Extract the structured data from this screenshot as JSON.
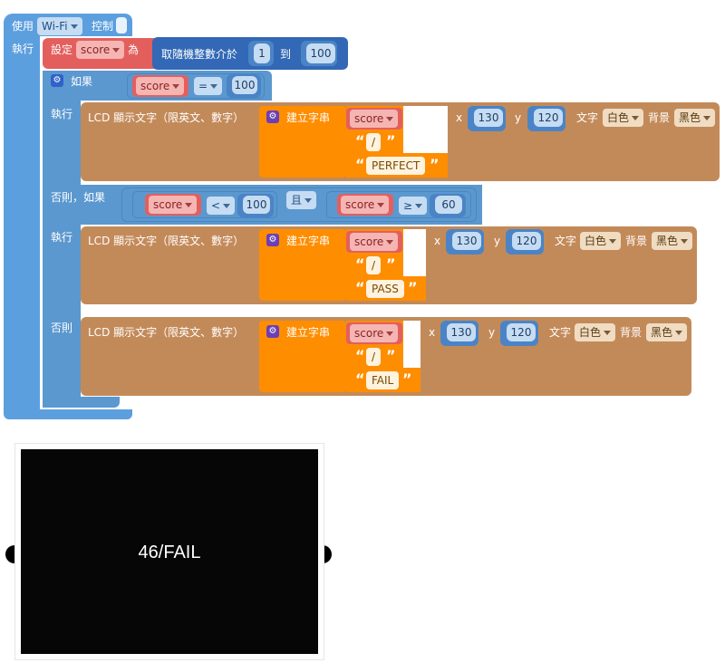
{
  "wifi_block": {
    "label_use": "使用",
    "wifi_option": "Wi-Fi",
    "label_control": "控制"
  },
  "main_block": {
    "label_do": "執行"
  },
  "set_block": {
    "label_set": "設定",
    "var": "score",
    "label_as": "為"
  },
  "random_block": {
    "label": "取隨機整數介於",
    "from": "1",
    "label_to": "到",
    "to": "100"
  },
  "if_block": {
    "label_if": "如果",
    "label_do": "執行",
    "label_elseif": "否則，如果",
    "label_do2": "執行",
    "label_else": "否則"
  },
  "cond1": {
    "var": "score",
    "op": "=",
    "value": "100"
  },
  "cond2": {
    "left": {
      "var": "score",
      "op": "<",
      "value": "100"
    },
    "logic": "且",
    "right": {
      "var": "score",
      "op": "≥",
      "value": "60"
    }
  },
  "lcd_blocks": [
    {
      "label": "LCD 顯示文字（限英文、數字）",
      "join_label": "建立字串",
      "var": "score",
      "sep": "/",
      "text": "PERFECT",
      "x_label": "x",
      "x": "130",
      "y_label": "y",
      "y": "120",
      "text_label": "文字",
      "text_color": "白色",
      "bg_label": "背景",
      "bg_color": "黑色"
    },
    {
      "label": "LCD 顯示文字（限英文、數字）",
      "join_label": "建立字串",
      "var": "score",
      "sep": "/",
      "text": "PASS",
      "x_label": "x",
      "x": "130",
      "y_label": "y",
      "y": "120",
      "text_label": "文字",
      "text_color": "白色",
      "bg_label": "背景",
      "bg_color": "黑色"
    },
    {
      "label": "LCD 顯示文字（限英文、數字）",
      "join_label": "建立字串",
      "var": "score",
      "sep": "/",
      "text": "FAIL",
      "x_label": "x",
      "x": "130",
      "y_label": "y",
      "y": "120",
      "text_label": "文字",
      "text_color": "白色",
      "bg_label": "背景",
      "bg_color": "黑色"
    }
  ],
  "lcd_screen": {
    "text": "46/FAIL"
  },
  "colors": {
    "control_blue": "#5c9fdf",
    "logic_blue": "#5b98cf",
    "variable_red": "#e35f5e",
    "math_blue": "#3268b5",
    "lcd_brown": "#c38a59",
    "text_orange": "#ff8d00",
    "screen": "#060606"
  }
}
